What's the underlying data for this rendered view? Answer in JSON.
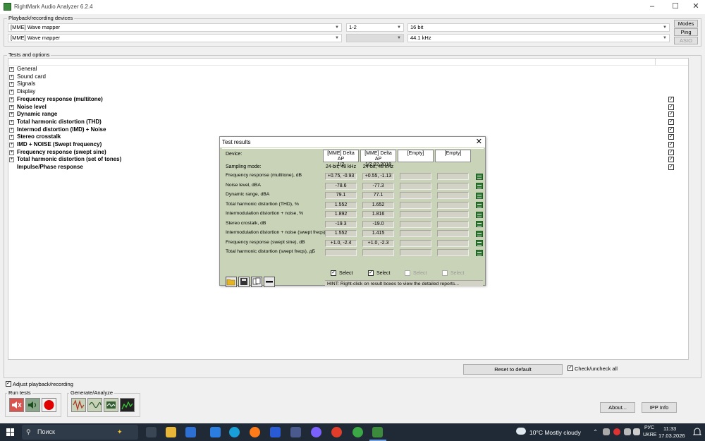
{
  "window": {
    "title": "RightMark Audio Analyzer 6.2.4"
  },
  "devices": {
    "group_label": "Playback/recording devices",
    "playback_device": "[MME] Wave mapper",
    "recording_device": "[MME] Wave mapper",
    "channels": "1-2",
    "bit_depth": "16 bit",
    "sample_rate": "44.1 kHz",
    "buttons": [
      "Modes",
      "Ping",
      "ASIO"
    ]
  },
  "tests": {
    "group_label": "Tests and options",
    "items": [
      {
        "label": "General",
        "bold": false,
        "checkbox": false,
        "expandable": true
      },
      {
        "label": "Sound card",
        "bold": false,
        "checkbox": false,
        "expandable": true
      },
      {
        "label": "Signals",
        "bold": false,
        "checkbox": false,
        "expandable": true
      },
      {
        "label": "Display",
        "bold": false,
        "checkbox": false,
        "expandable": true
      },
      {
        "label": "Frequency response (multitone)",
        "bold": true,
        "checkbox": true,
        "expandable": true
      },
      {
        "label": "Noise level",
        "bold": true,
        "checkbox": true,
        "expandable": true
      },
      {
        "label": "Dynamic range",
        "bold": true,
        "checkbox": true,
        "expandable": true
      },
      {
        "label": "Total harmonic distortion (THD)",
        "bold": true,
        "checkbox": true,
        "expandable": true
      },
      {
        "label": "Intermod distortion (IMD) + Noise",
        "bold": true,
        "checkbox": true,
        "expandable": true
      },
      {
        "label": "Stereo crosstalk",
        "bold": true,
        "checkbox": true,
        "expandable": true
      },
      {
        "label": "IMD + NOISE (Swept frequency)",
        "bold": true,
        "checkbox": true,
        "expandable": true
      },
      {
        "label": "Frequency response (swept sine)",
        "bold": true,
        "checkbox": true,
        "expandable": true
      },
      {
        "label": "Total harmonic distortion (set of tones)",
        "bold": true,
        "checkbox": true,
        "expandable": true
      },
      {
        "label": "Impulse/Phase response",
        "bold": true,
        "checkbox": true,
        "expandable": false
      }
    ]
  },
  "results": {
    "title": "Test results",
    "device_label": "Device:",
    "devices": [
      {
        "line1": "[MME] Delta AP",
        "line2": "1/2"
      },
      {
        "line1": "[MME] Delta AP",
        "line2": "1/2 02.2018"
      },
      {
        "line1": "[Empty]",
        "line2": ""
      },
      {
        "line1": "[Empty]",
        "line2": ""
      }
    ],
    "sampling_label": "Sampling mode:",
    "sampling": [
      "24-bit, 48 kHz",
      "24-bit, 48 kHz",
      "",
      ""
    ],
    "rows": [
      {
        "label": "Frequency response (multitone), dB",
        "values": [
          "+0.75, -0.93",
          "+0.55, -1.13",
          "",
          ""
        ]
      },
      {
        "label": "Noise level, dBA",
        "values": [
          "-78.6",
          "-77.3",
          "",
          ""
        ]
      },
      {
        "label": "Dynamic range, dBA",
        "values": [
          "79.1",
          "77.1",
          "",
          ""
        ]
      },
      {
        "label": "Total harmonic distortion (THD), %",
        "values": [
          "1.552",
          "1.652",
          "",
          ""
        ]
      },
      {
        "label": "Intermodulation distortion + noise, %",
        "values": [
          "1.892",
          "1.816",
          "",
          ""
        ]
      },
      {
        "label": "Stereo crostalk, dB",
        "values": [
          "-19.3",
          "-19.0",
          "",
          ""
        ]
      },
      {
        "label": "Intermodulation distortion + noise (swept freqs), %",
        "values": [
          "1.552",
          "1.415",
          "",
          ""
        ]
      },
      {
        "label": "Frequency response (swept sine), dB",
        "values": [
          "+1.0, -2.4",
          "+1.0, -2.3",
          "",
          ""
        ]
      },
      {
        "label": "Total harmonic distortion (swept freqs), дБ",
        "values": [
          "",
          "",
          "",
          ""
        ]
      }
    ],
    "select_label": "Select",
    "select_checked": [
      true,
      true,
      false,
      false
    ],
    "hint": "HINT: Right-click on result boxes to view the detailed reports..."
  },
  "bottom": {
    "reset_label": "Reset to default",
    "check_all_label": "Check/uncheck all",
    "adjust_label": "Adjust playback/recording",
    "run_tests_label": "Run tests",
    "generate_label": "Generate/Analyze",
    "about_label": "About...",
    "ipp_label": "IPP Info"
  },
  "taskbar": {
    "search_placeholder": "Поиск",
    "weather": "10°C  Mostly cloudy",
    "lang_1": "РУС",
    "lang_2": "UKRE",
    "time": "11:33",
    "date": "17.03.2026"
  },
  "colors": {
    "dialog_bg": "#c9d3b7",
    "taskbar_bg": "#1f2a36",
    "spreadsheet_icon": "#2e7d32",
    "record_red": "#e00000"
  }
}
